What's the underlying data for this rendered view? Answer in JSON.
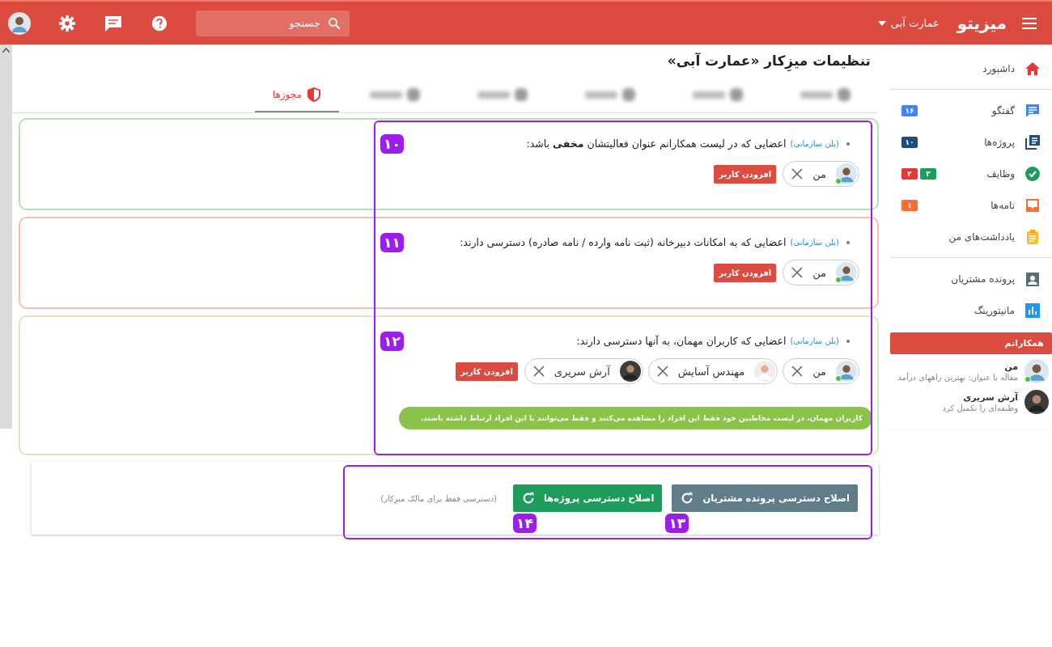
{
  "topbar": {
    "logo": "میزیتو",
    "workspace": "عمارت آبی",
    "search": {
      "placeholder": "جستجو"
    }
  },
  "page_title": "تنظیمات میزِکار «عمارت آبی»",
  "tabs": [
    {
      "kind": "blurred",
      "selected": false
    },
    {
      "kind": "blurred",
      "selected": false
    },
    {
      "kind": "blurred",
      "selected": false
    },
    {
      "kind": "blurred",
      "selected": false
    },
    {
      "kind": "blurred",
      "selected": false
    },
    {
      "kind": "label",
      "label": "مجوزها",
      "selected": true
    }
  ],
  "sections": [
    {
      "color": "#b8e0b4",
      "plan": "(پلن سازمانی)",
      "text": "اعضایی که در لیست همکارانم عنوان فعالیتشان **مخفی** باشد:",
      "annotation": "۱۰",
      "add_button": "افزودن کاربر",
      "members": [
        {
          "name": "من",
          "online": true
        }
      ]
    },
    {
      "color": "#f5bfae",
      "plan": "(پلن سازمانی)",
      "text": "اعضایی که به امکانات دبیرخانه (ثبت نامه وارده / نامه صادره) دسترسی دارند:",
      "annotation": "۱۱",
      "add_button": "افزودن کاربر",
      "members": [
        {
          "name": "من",
          "online": true
        }
      ]
    },
    {
      "color": "#d9e7c2",
      "plan": "(پلن سازمانی)",
      "text": "اعضایی که کاربران مهمان، به آنها دسترسی دارند:",
      "annotation": "۱۲",
      "add_button": "افزودن کاربر",
      "members": [
        {
          "name": "من",
          "online": true
        },
        {
          "name": "مهندس آسایش",
          "online": false
        },
        {
          "name": "آرش سریری",
          "online": false
        }
      ],
      "note": "کاربران مهمان، در لیست مخاطبین خود فقط این افراد را مشاهده می‌کنند و فقط می‌توانند با این افراد ارتباط داشته باشند."
    }
  ],
  "actions": {
    "buttons": [
      {
        "label": "اصلاح دسترسی پرونده مشتریان",
        "color": "#627d8a",
        "annotation": "۱۳"
      },
      {
        "label": "اصلاح دسترسی پروژه‌ها",
        "color": "#1e9c5c",
        "annotation": "۱۴"
      }
    ],
    "note": "(دسترسی فقط برای مالک میزِکار)"
  },
  "sidebar": {
    "groups": [
      [
        {
          "kind": "home",
          "label": "داشبورد"
        }
      ],
      [
        {
          "kind": "chat",
          "label": "گفتگو",
          "badges": [
            {
              "text": "۱۶",
              "color": "#4285f4"
            }
          ]
        },
        {
          "kind": "projects",
          "label": "پروژه‌ها",
          "badges": [
            {
              "text": "۱۰",
              "color": "#1f4e79"
            }
          ]
        },
        {
          "kind": "tasks",
          "label": "وظایف",
          "badges": [
            {
              "text": "۳",
              "color": "#1e9c5c"
            },
            {
              "text": "۲",
              "color": "#e53935"
            }
          ]
        },
        {
          "kind": "mail",
          "label": "نامه‌ها",
          "badges": [
            {
              "text": "۱",
              "color": "#ff6d33"
            }
          ]
        },
        {
          "kind": "notes",
          "label": "یادداشت‌های من"
        }
      ],
      [
        {
          "kind": "contacts",
          "label": "پرونده مشتریان"
        },
        {
          "kind": "monitor",
          "label": "مانیتورینگ"
        }
      ]
    ]
  },
  "colleagues": {
    "title": "همکارانم",
    "people": [
      {
        "name": "من",
        "status": "مقاله با عنوان: بهترین راههای درآمد",
        "online": true
      },
      {
        "name": "آرش سریری",
        "status": "وظیفه‌ای را تکمیل کرد",
        "online": false
      }
    ]
  }
}
